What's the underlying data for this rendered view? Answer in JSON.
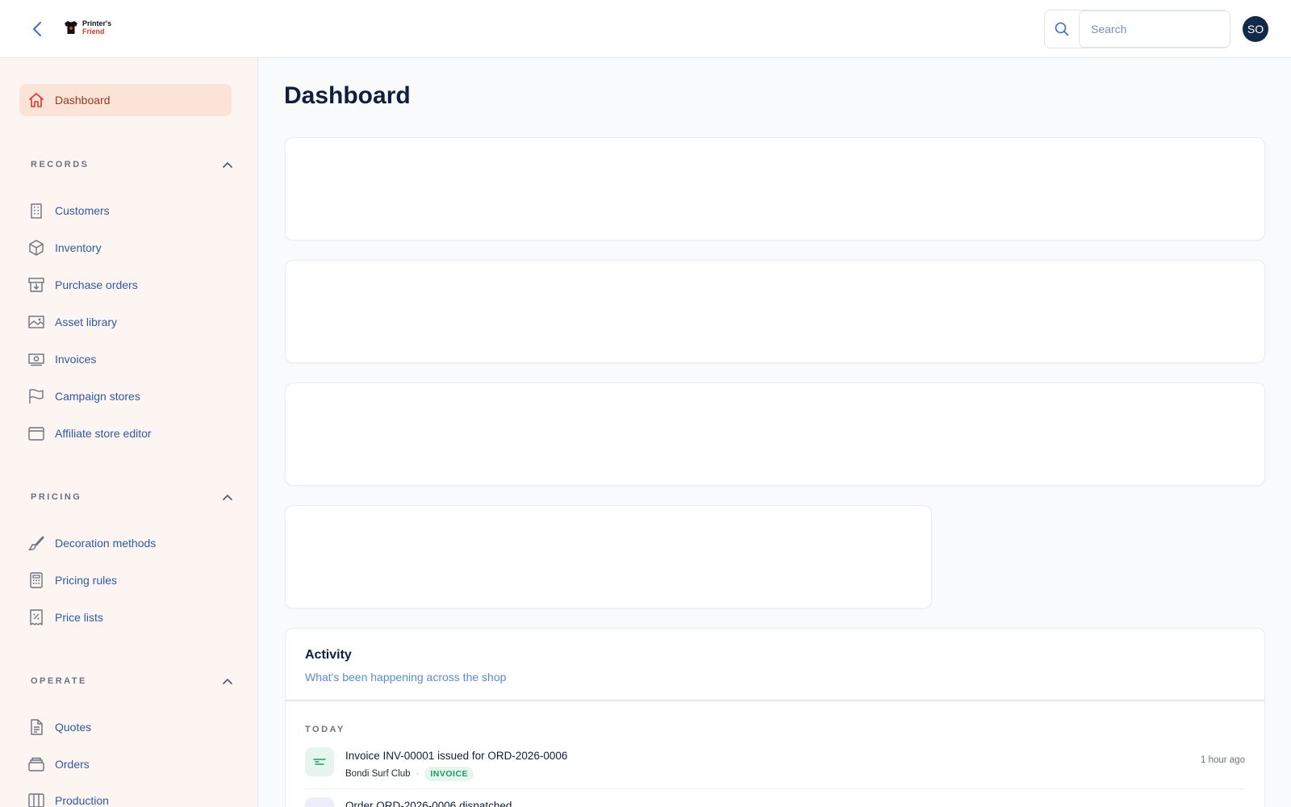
{
  "header": {
    "logo": {
      "line1": "Printer's",
      "line2": "Friend"
    },
    "search": {
      "placeholder": "Search",
      "value": ""
    },
    "avatar_initials": "SO"
  },
  "sidebar": {
    "dashboard_label": "Dashboard",
    "sections": {
      "records": {
        "label": "RECORDS",
        "items": [
          "Customers",
          "Inventory",
          "Purchase orders",
          "Asset library",
          "Invoices",
          "Campaign stores",
          "Affiliate store editor"
        ]
      },
      "pricing": {
        "label": "PRICING",
        "items": [
          "Decoration methods",
          "Pricing rules",
          "Price lists"
        ]
      },
      "operate": {
        "label": "OPERATE",
        "items": [
          "Quotes",
          "Orders",
          "Production"
        ]
      }
    }
  },
  "main": {
    "title": "Dashboard",
    "activity": {
      "title": "Activity",
      "subtitle": "What's been happening across the shop",
      "day_label": "TODAY",
      "items": [
        {
          "title": "Invoice INV-00001 issued for ORD-2026-0006",
          "customer": "Bondi Surf Club",
          "badge": "INVOICE",
          "time": "1 hour ago"
        },
        {
          "title": "Order ORD-2026-0006 dispatched",
          "customer": "",
          "badge": "",
          "time": ""
        }
      ]
    }
  },
  "colors": {
    "accent": "#e0352b",
    "sidebar_bg": "#fdf5f1",
    "active_bg": "#fbe3d8",
    "link": "#2c5aa8",
    "avatar_bg": "#13294b"
  }
}
